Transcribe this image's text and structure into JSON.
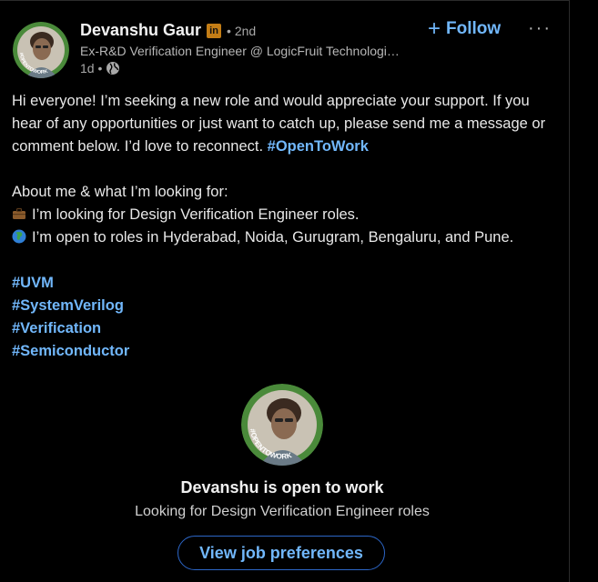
{
  "post": {
    "author_name": "Devanshu Gaur",
    "linkedin_badge": "in",
    "degree": "• 2nd",
    "headline": "Ex-R&D Verification Engineer @ LogicFruit Technologi…",
    "timestamp": "1d •",
    "follow_label": "Follow",
    "more_label": "···",
    "avatar_frame_text": "#OPENTOWORK",
    "text": {
      "para1": "Hi everyone! I’m seeking a new role and would appreciate your support. If you hear of any opportunities or just want to catch up, please send me a message or comment below. I’d love to reconnect. ",
      "para1_hashtag": "#OpenToWork",
      "about_heading": "About me & what I’m looking for:",
      "bullet1": "I’m looking for Design Verification Engineer roles.",
      "bullet2": "I’m open to roles in Hyderabad, Noida, Gurugram, Bengaluru, and Pune.",
      "hashtags": [
        "#UVM",
        "#SystemVerilog",
        "#Verification",
        "#Semiconductor"
      ]
    },
    "open_to_work": {
      "title": "Devanshu is open to work",
      "subtitle": "Looking for Design Verification Engineer roles",
      "button_label": "View job preferences"
    },
    "colors": {
      "accent_link": "#71b7fb",
      "opentowork_green": "#4a8a3a",
      "badge_gold": "#c37d16"
    }
  }
}
